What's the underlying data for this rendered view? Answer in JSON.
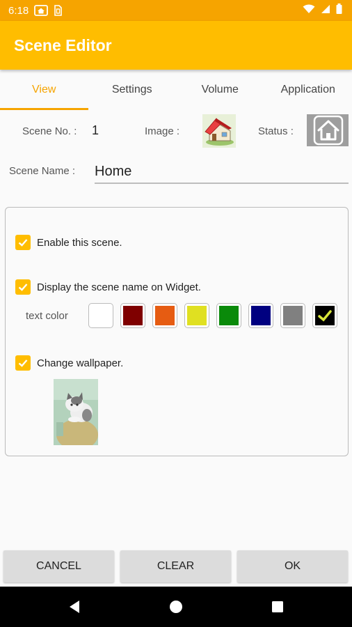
{
  "status_bar": {
    "time": "6:18"
  },
  "app_bar": {
    "title": "Scene Editor"
  },
  "tabs": [
    {
      "label": "View",
      "active": true
    },
    {
      "label": "Settings",
      "active": false
    },
    {
      "label": "Volume",
      "active": false
    },
    {
      "label": "Application",
      "active": false
    }
  ],
  "scene": {
    "number_label": "Scene No. :",
    "number_value": "1",
    "image_label": "Image :",
    "status_label": "Status :",
    "name_label": "Scene Name :",
    "name_value": "Home"
  },
  "options": {
    "enable_label": "Enable this scene.",
    "enable_checked": true,
    "display_name_label": "Display the scene name on Widget.",
    "display_name_checked": true,
    "text_color_label": "text color",
    "text_colors": [
      "#ffffff",
      "#7f0000",
      "#e65c12",
      "#e0e021",
      "#0a8a0a",
      "#000080",
      "#808080",
      "#000000"
    ],
    "selected_color_index": 7,
    "wallpaper_label": "Change wallpaper.",
    "wallpaper_checked": true
  },
  "buttons": {
    "cancel": "CANCEL",
    "clear": "CLEAR",
    "ok": "OK"
  },
  "colors": {
    "primary": "#ffbd00",
    "status_bar": "#f6a400",
    "accent": "#f6a400"
  }
}
